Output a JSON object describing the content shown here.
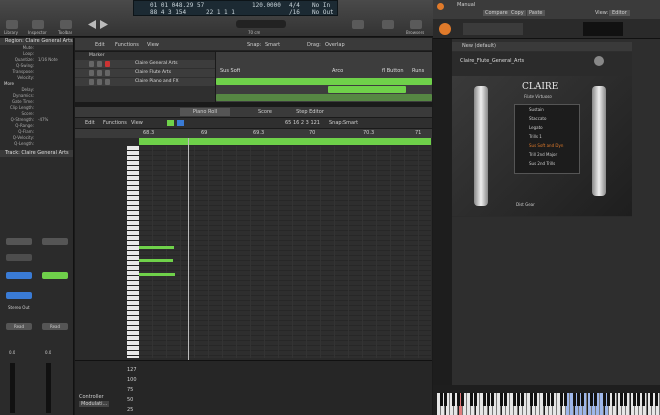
{
  "toolbar": {
    "items": [
      "Library",
      "Inspector",
      "Toolbar",
      "Smart Controls",
      "Mixer",
      "Editors"
    ],
    "lcd_bars": "01 01 048.29 57",
    "lcd_beats": "88  4  3  154",
    "lcd_sub": "22  1  1  1",
    "tempo": "120.0000",
    "sig": "4/4",
    "div": "/16",
    "nocount": "No In",
    "noout": "No Out",
    "keep": "Keep",
    "loops": "Loops",
    "notepads": "Notepads",
    "browsers": "Browsers",
    "zoom_label": "70 cm"
  },
  "inspector": {
    "region_title": "Region: Claire General Arts",
    "mute_label": "Mute:",
    "loop_label": "Loop:",
    "quantize_label": "Quantize:",
    "quantize_val": "1/16 Note",
    "qswing_label": "Q-Swing:",
    "transpose_label": "Transpose:",
    "velocity_label": "Velocity:",
    "more_label": "More",
    "delay_label": "Delay:",
    "dynamics_label": "Dynamics:",
    "gate_label": "Gate Time:",
    "cliplength_label": "Clip Length:",
    "score_label": "Score:",
    "qstrength_label": "Q-Strength:",
    "qstrength_val": "-47%",
    "qrange_label": "Q-Range:",
    "qflam_label": "Q-Flam:",
    "qvelocity_label": "Q-Velocity:",
    "qlength_label": "Q-Length:",
    "track_title": "Track: Claire General Arts",
    "eq_label": "EQ",
    "setting_label": "Setting",
    "midi_fx": "MIDI FX",
    "stereo_out": "Stereo Out",
    "read": "Read",
    "val_a": "0.0",
    "val_b": "0.0"
  },
  "tracks": {
    "edit": "Edit",
    "functions": "Functions",
    "view": "View",
    "snap": "Snap:",
    "snap_val": "Smart",
    "drag": "Drag:",
    "drag_val": "Overlap",
    "marker": "Marker",
    "rows": [
      {
        "name": "Claire General Arts",
        "color": "#6fd14a"
      },
      {
        "name": "Claire Flute Arts",
        "color": "#6fd14a"
      },
      {
        "name": "Claire Piano and FX",
        "color": "#6fd14a"
      }
    ],
    "labels": [
      "Sus Soft",
      "Arco",
      "fl Button",
      "Runs"
    ]
  },
  "editor": {
    "tabs": [
      "Piano Roll",
      "Score",
      "Step Editor"
    ],
    "edit": "Edit",
    "functions": "Functions",
    "view": "View",
    "pos": "65 16 2 3 121",
    "snap": "Snap:",
    "snap_val": "Smart",
    "ruler": [
      "68.3",
      "69",
      "69.3",
      "70",
      "70.3",
      "71"
    ],
    "controller_label": "Controller",
    "controller_sel": "Modulati...",
    "ctrl_scale": [
      "127",
      "100",
      "75",
      "50",
      "25"
    ]
  },
  "kontakt": {
    "title": "Manual",
    "view": "View:",
    "view_val": "Editor",
    "presets": [
      "Compare",
      "Copy",
      "Paste"
    ],
    "multi": "New (default)",
    "inst_name": "Claire_Flute_General_Arts",
    "brand": "CLAIRE",
    "subtitle": "Flute Virtuoso",
    "artics": [
      "Sustain",
      "Staccato",
      "Legato",
      "Trills 1",
      "Sus Soft and Dyn",
      "Trill 2nd Major",
      "Sus 2nd Trills"
    ],
    "logo": "Dist Gear"
  },
  "colors": {
    "green": "#6fd14a",
    "accent": "#e07a2a",
    "blue": "#3a7bd5"
  }
}
